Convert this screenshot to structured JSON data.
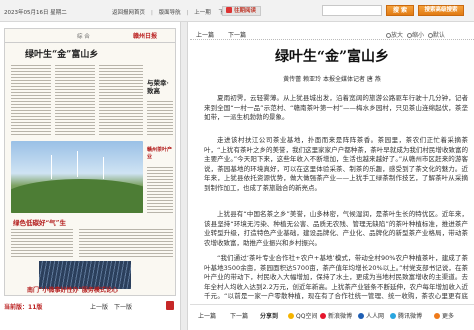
{
  "topbar": {
    "date": "2023年05月16日 星期二",
    "nav_home": "返回报网首页",
    "nav_plate": "版面导航",
    "nav_prev": "上一期",
    "nav_next": "下一期",
    "past_label": "往期阅读",
    "search_button": "搜 索",
    "advanced_button": "搜索高级搜索"
  },
  "page": {
    "section_tag": "综 合",
    "paper_name": "赣州日报",
    "headline": "绿叶生“金”富山乡",
    "side_head": "与荣幸·致高",
    "red_head_1": "赣州茶叶产业",
    "red_head_2": "绿色低碳好“气”生",
    "red_head_3": "南门“小微事好性办”服务模式论心",
    "label_prefix": "当前版：",
    "label_value": "11版",
    "prev": "上一版",
    "next": "下一版"
  },
  "article": {
    "prev": "上一篇",
    "next": "下一篇",
    "tools": [
      "放大",
      "缩小",
      "默认"
    ],
    "title": "绿叶生“金”富山乡",
    "byline": "黄传蕾 赖亚玲 本报全媒体记者 唐 燕",
    "paragraphs": [
      "夏雨初霁，云轻雾薄。从上犹县城出发，沿着宽阔的旅游公路驱车行驶十几分钟，记者来到全国“一村一品”示范村、“赣南茶叶第一村”——梅水乡园村，只见茶山连绵起伏，茶垄如带，一派生机勃勃的景象。",
      "走进该村扶江公司茶业基地，扑面而来是阵阵茶香。茶园里，茶农们正忙着采摘茶叶，“上犹有茶叶之乡的美誉，我们这里家家户户都种茶，茶叶早就成为我们村民增收致富的主要产业。”今天阳下来，这些年收入不断增加，生活也越来越好了。”从赣州市区赶来的游客说，茶园基地的环境真好，可以在这里体验采茶、制茶的乐趣，感受到了茶文化的魅力。近年来，上犹县依托资源优势，做大做强茶产业——上犹手工绿茶制作技艺，了解茶叶从采摘到制作加工，也成了茶旅融合的新亮点。",
      "上犹县有“中国名茶之乡”美誉，山多林密，气候湿润，是茶叶生长的特优区。近年来，该县坚持“环境无污染、种植无公害、品质无农残、管理无缺陷”的茶叶种植标准，推进茶产业转型升级，打造特色产业基础，建设品牌化、产业化、品牌化的新型茶产业格局，带动茶农增收致富，助推产业振兴和乡村振兴。",
      "“我们通过‘茶叶专业合作社+农户+基地’模式，带动全村90%农户种植茶叶，建成了茶叶基地3500余亩，茶园面积达5700亩，茶产值年均增长20%以上。”村党支部书记说，在茶叶产业的带动下，村民收入大幅增加，保持了水土，更成为当地村民致富增收的主渠道。去年全村人均收入达到2.2万元，创近年新高。上犹茶产业链条不断延伸，农户每年增加收入近千元。“以前是一家一户零散种植，现在有了合作社统一管理、统一收购，茶农心里更有底了。”该县深入推进茶产业发展，不断做优种苗、茶园、加工、销售等环节，打造有机茶园，提升品牌附加值，为乡村振兴注入强劲动力。"
    ]
  },
  "share": {
    "label": "分享到",
    "services": [
      {
        "name": "QQ空间",
        "color": "#f5b400"
      },
      {
        "name": "新浪微博",
        "color": "#e6162d"
      },
      {
        "name": "人人网",
        "color": "#1f5fb4"
      },
      {
        "name": "腾讯微博",
        "color": "#2aa6e0"
      },
      {
        "name": "更多",
        "color": "#ef7a1a"
      }
    ]
  },
  "colors": {
    "accent_orange": "#e07b14",
    "headline_red": "#b31d1d"
  }
}
